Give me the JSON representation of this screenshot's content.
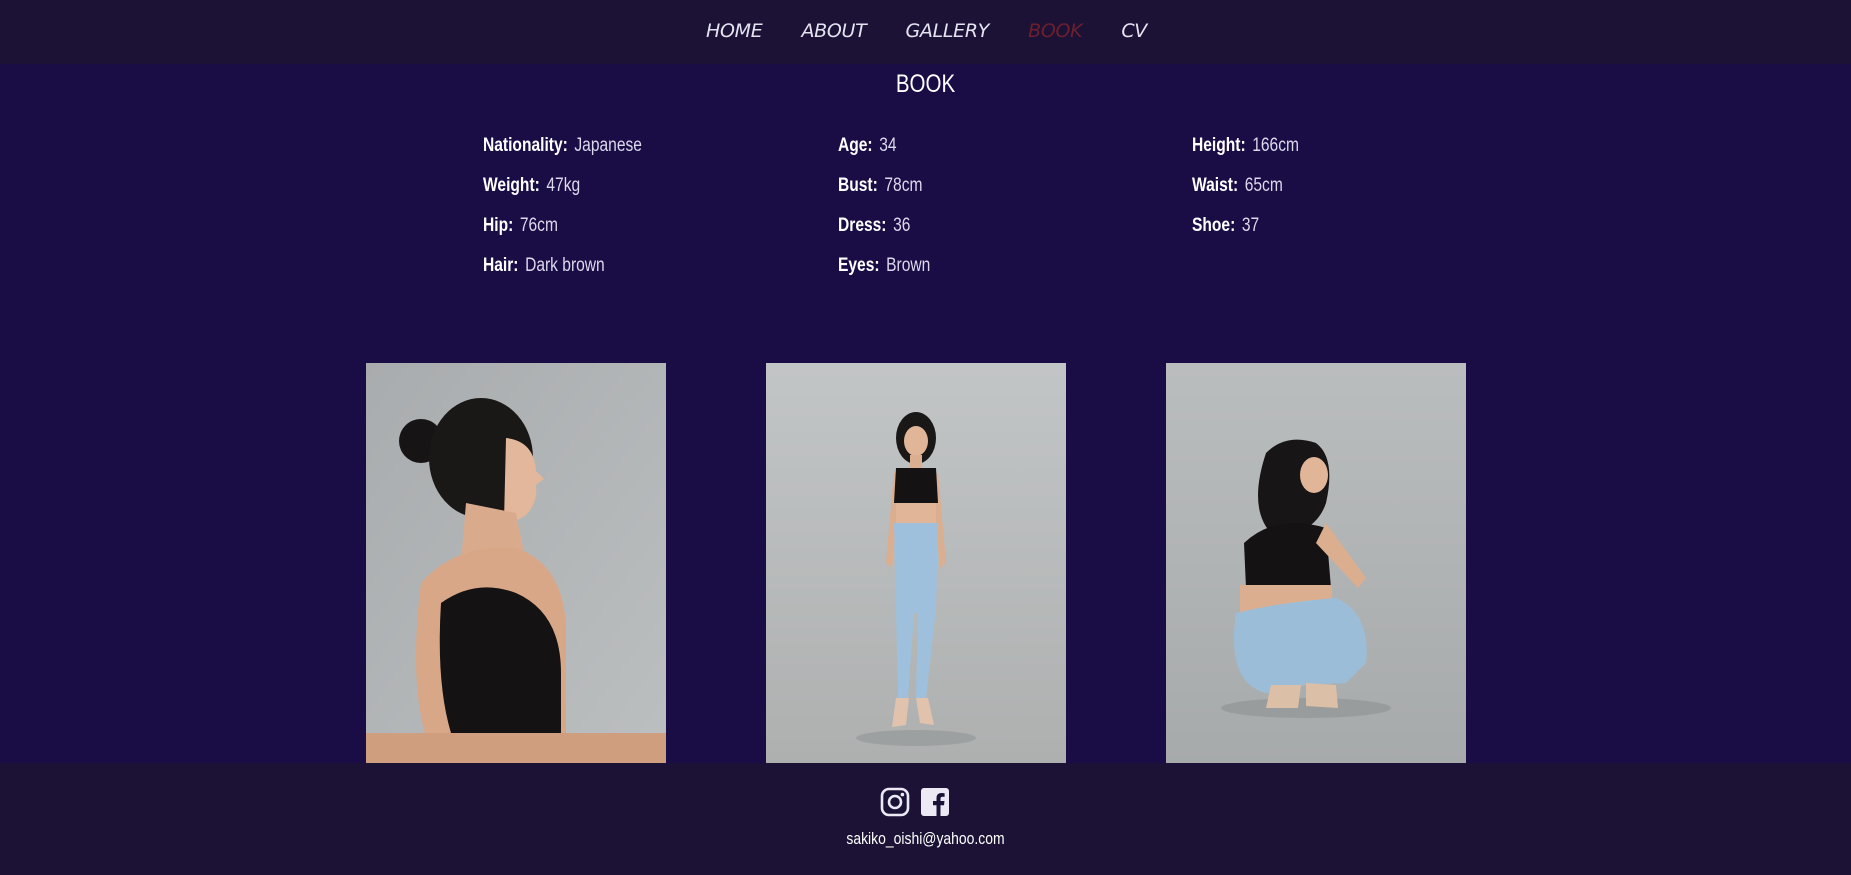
{
  "nav": {
    "items": [
      {
        "label": "HOME",
        "active": false
      },
      {
        "label": "ABOUT",
        "active": false
      },
      {
        "label": "GALLERY",
        "active": false
      },
      {
        "label": "BOOK",
        "active": true
      },
      {
        "label": "CV",
        "active": false
      }
    ]
  },
  "page": {
    "title": "BOOK"
  },
  "stats": [
    {
      "label": "Nationality:",
      "value": "Japanese"
    },
    {
      "label": "Age:",
      "value": "34"
    },
    {
      "label": "Height:",
      "value": "166cm"
    },
    {
      "label": "Weight:",
      "value": "47kg"
    },
    {
      "label": "Bust:",
      "value": "78cm"
    },
    {
      "label": "Waist:",
      "value": "65cm"
    },
    {
      "label": "Hip:",
      "value": "76cm"
    },
    {
      "label": "Dress:",
      "value": "36"
    },
    {
      "label": "Shoe:",
      "value": "37"
    },
    {
      "label": "Hair:",
      "value": "Dark brown"
    },
    {
      "label": "Eyes:",
      "value": "Brown"
    }
  ],
  "footer": {
    "social": [
      {
        "icon": "instagram-icon"
      },
      {
        "icon": "facebook-icon"
      }
    ],
    "email": "sakiko_oishi@yahoo.com"
  },
  "colors": {
    "background": "#1a0c45",
    "bar": "#1b1236",
    "active_nav": "#6e1f2e",
    "text": "#ffffff"
  }
}
